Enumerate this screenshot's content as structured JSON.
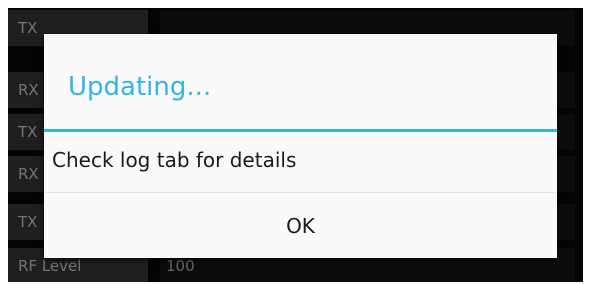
{
  "background_rows": [
    {
      "label": "TX",
      "value": ""
    },
    {
      "label": "RX",
      "value": ""
    },
    {
      "label": "TX",
      "value": ""
    },
    {
      "label": "RX",
      "value": ""
    },
    {
      "label": "TX",
      "value": ""
    },
    {
      "label": "RF Level",
      "value": "100"
    }
  ],
  "dialog": {
    "title": "Updating...",
    "message": "Check log tab for details",
    "ok_label": "OK"
  },
  "colors": {
    "accent": "#34b5e5",
    "dialog_background": "#fafafa",
    "screen_background": "#060606"
  }
}
